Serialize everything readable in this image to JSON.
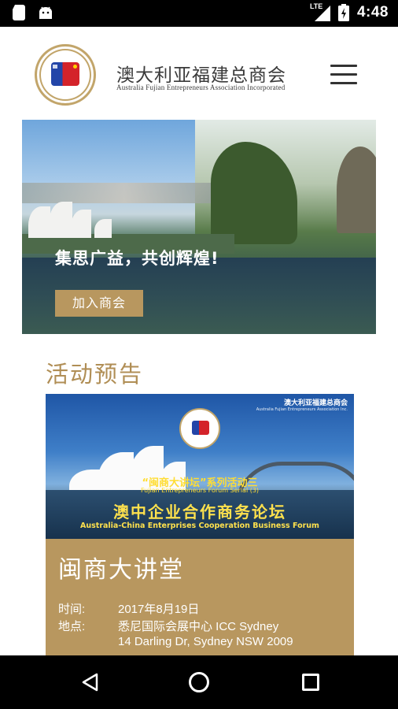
{
  "status_bar": {
    "time": "4:48",
    "network": "LTE",
    "icons": [
      "sd-card-icon",
      "android-icon",
      "signal-icon",
      "battery-charging-icon"
    ]
  },
  "header": {
    "brand_cn": "澳大利亚福建总商会",
    "brand_en": "Australia Fujian Entrepreneurs Association Incorporated",
    "menu_icon": "hamburger-menu-icon"
  },
  "hero": {
    "tagline": "集思广益，共创辉煌!",
    "join_button": "加入商会"
  },
  "events_section": {
    "title": "活动预告"
  },
  "event": {
    "poster": {
      "brand_cn": "澳大利亚福建总商会",
      "brand_en": "Australia Fujian Entrepreneurs Association Inc.",
      "series_cn": "“闽商大讲坛”系列活动三",
      "series_en": "Fujian Entrepreneurs Forum Serial (3)",
      "forum_cn": "澳中企业合作商务论坛",
      "forum_en": "Australia-China Enterprises Cooperation Business Forum"
    },
    "title": "闽商大讲堂",
    "time_label": "时间:",
    "time_value": "2017年8月19日",
    "location_label": "地点:",
    "location_line1": "悉尼国际会展中心 ICC Sydney",
    "location_line2": "14 Darling Dr, Sydney NSW 2009"
  },
  "nav_bar": {
    "back_icon": "back-triangle-icon",
    "home_icon": "home-circle-icon",
    "recent_icon": "recent-apps-square-icon"
  },
  "colors": {
    "gold": "#b8975f",
    "section_title": "#b08e55",
    "status_bar": "#000000"
  }
}
